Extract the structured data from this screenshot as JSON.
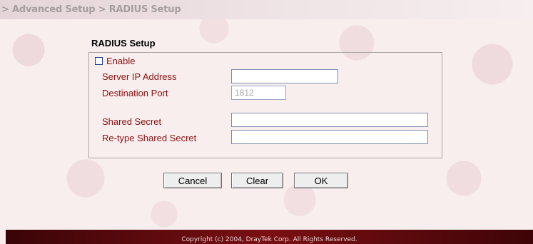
{
  "breadcrumb": "> Advanced Setup > RADIUS Setup",
  "section_title": "RADIUS Setup",
  "form": {
    "enable": {
      "label": "Enable",
      "checked": false
    },
    "server_ip": {
      "label": "Server IP Address",
      "value": ""
    },
    "destination_port": {
      "label": "Destination Port",
      "value": "1812"
    },
    "shared_secret": {
      "label": "Shared Secret",
      "value": ""
    },
    "retype_shared_secret": {
      "label": "Re-type Shared Secret",
      "value": ""
    }
  },
  "buttons": {
    "cancel": "Cancel",
    "clear": "Clear",
    "ok": "OK"
  },
  "footer": {
    "copyright": "Copyright (c) 2004, DrayTek Corp. All Rights Reserved."
  },
  "colors": {
    "label_text": "#8a1010",
    "footer_bg": "#6a0b10",
    "breadcrumb_text": "#a59da0",
    "checkbox_border": "#1e3f8f"
  }
}
